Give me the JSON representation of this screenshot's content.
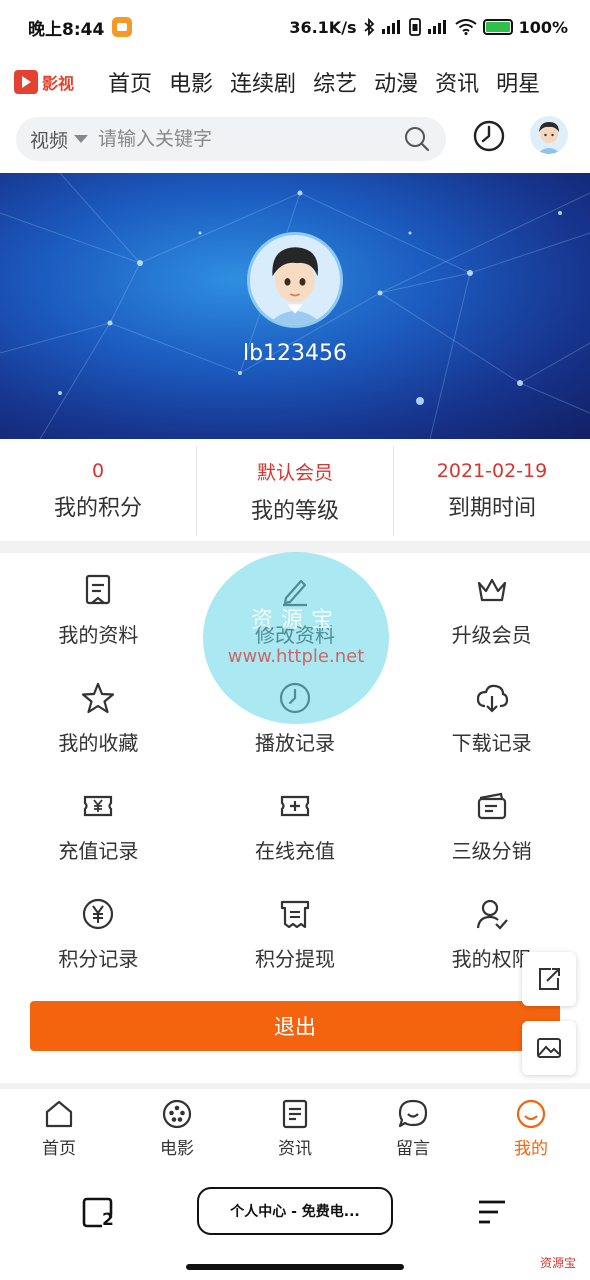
{
  "status_bar": {
    "time": "晚上8:44",
    "net_speed": "36.1K/s",
    "battery": "100%"
  },
  "top_nav": {
    "logo_text": "影视",
    "items": [
      "首页",
      "电影",
      "连续剧",
      "综艺",
      "动漫",
      "资讯",
      "明星"
    ]
  },
  "search": {
    "type_label": "视频",
    "placeholder": "请输入关键字"
  },
  "profile": {
    "username": "lb123456"
  },
  "stats": [
    {
      "value": "0",
      "label": "我的积分"
    },
    {
      "value": "默认会员",
      "label": "我的等级"
    },
    {
      "value": "2021-02-19",
      "label": "到期时间"
    }
  ],
  "menu": [
    {
      "label": "我的资料",
      "icon": "profile-doc-icon"
    },
    {
      "label": "修改资料",
      "icon": "pencil-icon"
    },
    {
      "label": "升级会员",
      "icon": "crown-icon"
    },
    {
      "label": "我的收藏",
      "icon": "star-icon"
    },
    {
      "label": "播放记录",
      "icon": "clock-icon"
    },
    {
      "label": "下载记录",
      "icon": "cloud-download-icon"
    },
    {
      "label": "充值记录",
      "icon": "yen-ticket-icon"
    },
    {
      "label": "在线充值",
      "icon": "plus-ticket-icon"
    },
    {
      "label": "三级分销",
      "icon": "share-card-icon"
    },
    {
      "label": "积分记录",
      "icon": "yen-circle-icon"
    },
    {
      "label": "积分提现",
      "icon": "receipt-icon"
    },
    {
      "label": "我的权限",
      "icon": "user-check-icon"
    }
  ],
  "watermark": {
    "name": "资源宝",
    "url": "www.httple.net"
  },
  "logout_label": "退出",
  "tabbar": [
    {
      "label": "首页",
      "icon": "home-icon",
      "active": false
    },
    {
      "label": "电影",
      "icon": "film-reel-icon",
      "active": false
    },
    {
      "label": "资讯",
      "icon": "news-icon",
      "active": false
    },
    {
      "label": "留言",
      "icon": "chat-bubble-icon",
      "active": false
    },
    {
      "label": "我的",
      "icon": "smiley-icon",
      "active": true
    }
  ],
  "system_nav": {
    "tab_count": "2",
    "pill_text": "个人中心 - 免费电..."
  },
  "corner_mark": "资源宝",
  "colors": {
    "accent": "#f4640f",
    "stat_value": "#d8352f",
    "logo": "#e2422f"
  }
}
